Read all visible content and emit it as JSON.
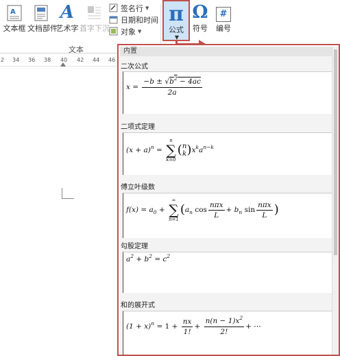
{
  "ribbon": {
    "group_label": "文本",
    "buttons": {
      "textbox": "文本框",
      "quickparts": "文档部件",
      "wordart": "艺术字",
      "dropcap": "首字下沉",
      "signature": "签名行",
      "datetime": "日期和时间",
      "object": "对象",
      "equation": "公式",
      "symbol": "符号",
      "number": "编号"
    },
    "glyphs": {
      "equation": "π",
      "symbol": "Ω",
      "number": "#",
      "wordart": "A"
    }
  },
  "ruler": {
    "ticks": [
      "2",
      "34",
      "36",
      "38",
      "40",
      "42",
      "44",
      "46"
    ]
  },
  "gallery": {
    "section_label": "内置",
    "items": [
      {
        "title": "二次公式"
      },
      {
        "title": "二项式定理"
      },
      {
        "title": "傅立叶级数"
      },
      {
        "title": "勾股定理"
      },
      {
        "title": "和的展开式"
      }
    ]
  },
  "colors": {
    "highlight_border": "#c0504d",
    "accent_blue": "#2a6ebb",
    "selected_fill": "#cde3f7"
  }
}
